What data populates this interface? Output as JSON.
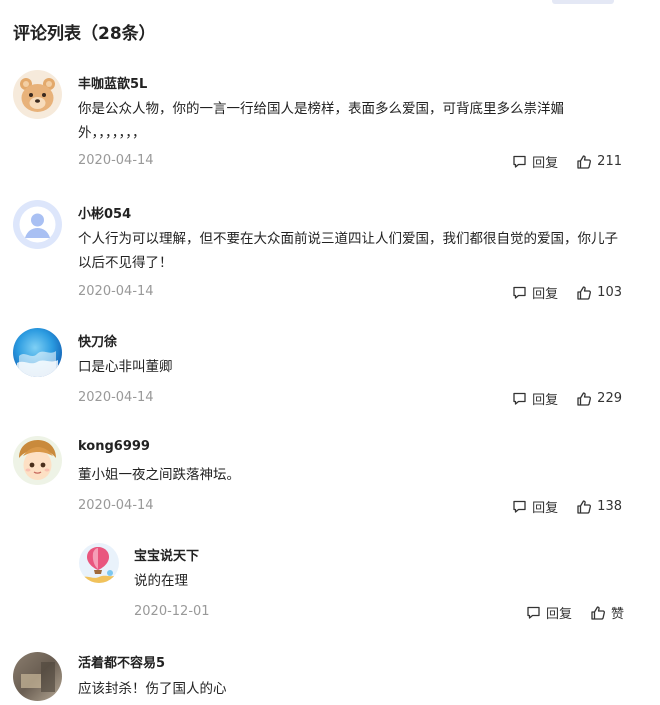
{
  "header": {
    "title": "评论列表（28条）"
  },
  "comments": [
    {
      "username": "丰咖蓝歆5L",
      "text": "你是公众人物，你的一言一行给国人是榜样，表面多么爱国，可背底里多么祟洋媚外，，，，，，，",
      "date": "2020-04-14",
      "reply_label": "回复",
      "likes": "211",
      "avatar_icon": "bear-avatar-icon"
    },
    {
      "username": "小彬054",
      "text": "个人行为可以理解，但不要在大众面前说三道四让人们爱国，我们都很自觉的爱国，你儿子以后不见得了！",
      "date": "2020-04-14",
      "reply_label": "回复",
      "likes": "103",
      "avatar_icon": "default-user-avatar-icon"
    },
    {
      "username": "快刀徐",
      "text": "口是心非叫董卿",
      "date": "2020-04-14",
      "reply_label": "回复",
      "likes": "229",
      "avatar_icon": "blue-ocean-avatar-icon"
    },
    {
      "username": "kong6999",
      "text": "董小姐一夜之间跌落神坛。",
      "date": "2020-04-14",
      "reply_label": "回复",
      "likes": "138",
      "avatar_icon": "cartoon-child-avatar-icon"
    },
    {
      "username": "宝宝说天下",
      "text": "说的在理",
      "date": "2020-12-01",
      "reply_label": "回复",
      "likes": "赞",
      "avatar_icon": "hot-air-balloon-avatar-icon"
    },
    {
      "username": "活着都不容易5",
      "text": "应该封杀！伤了国人的心",
      "avatar_icon": "photo-avatar-icon"
    }
  ]
}
